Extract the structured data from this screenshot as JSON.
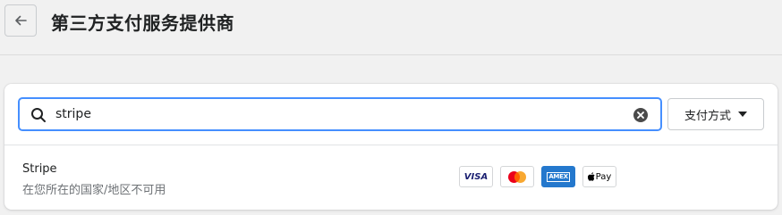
{
  "header": {
    "title": "第三方支付服务提供商"
  },
  "search": {
    "value": "stripe",
    "placeholder": ""
  },
  "filter": {
    "label": "支付方式"
  },
  "results": [
    {
      "name": "Stripe",
      "status": "在您所在的国家/地区不可用",
      "payment_methods": [
        {
          "name": "visa-icon",
          "text": "VISA"
        },
        {
          "name": "mastercard-icon",
          "text": ""
        },
        {
          "name": "amex-icon",
          "text": "AMEX"
        },
        {
          "name": "apple-pay-icon",
          "text": "Pay"
        }
      ]
    }
  ],
  "colors": {
    "accent": "#458fff",
    "visa": "#1a1f71",
    "mastercard_red": "#eb001b",
    "mastercard_yellow": "#f79e1b",
    "amex": "#2478cd"
  }
}
